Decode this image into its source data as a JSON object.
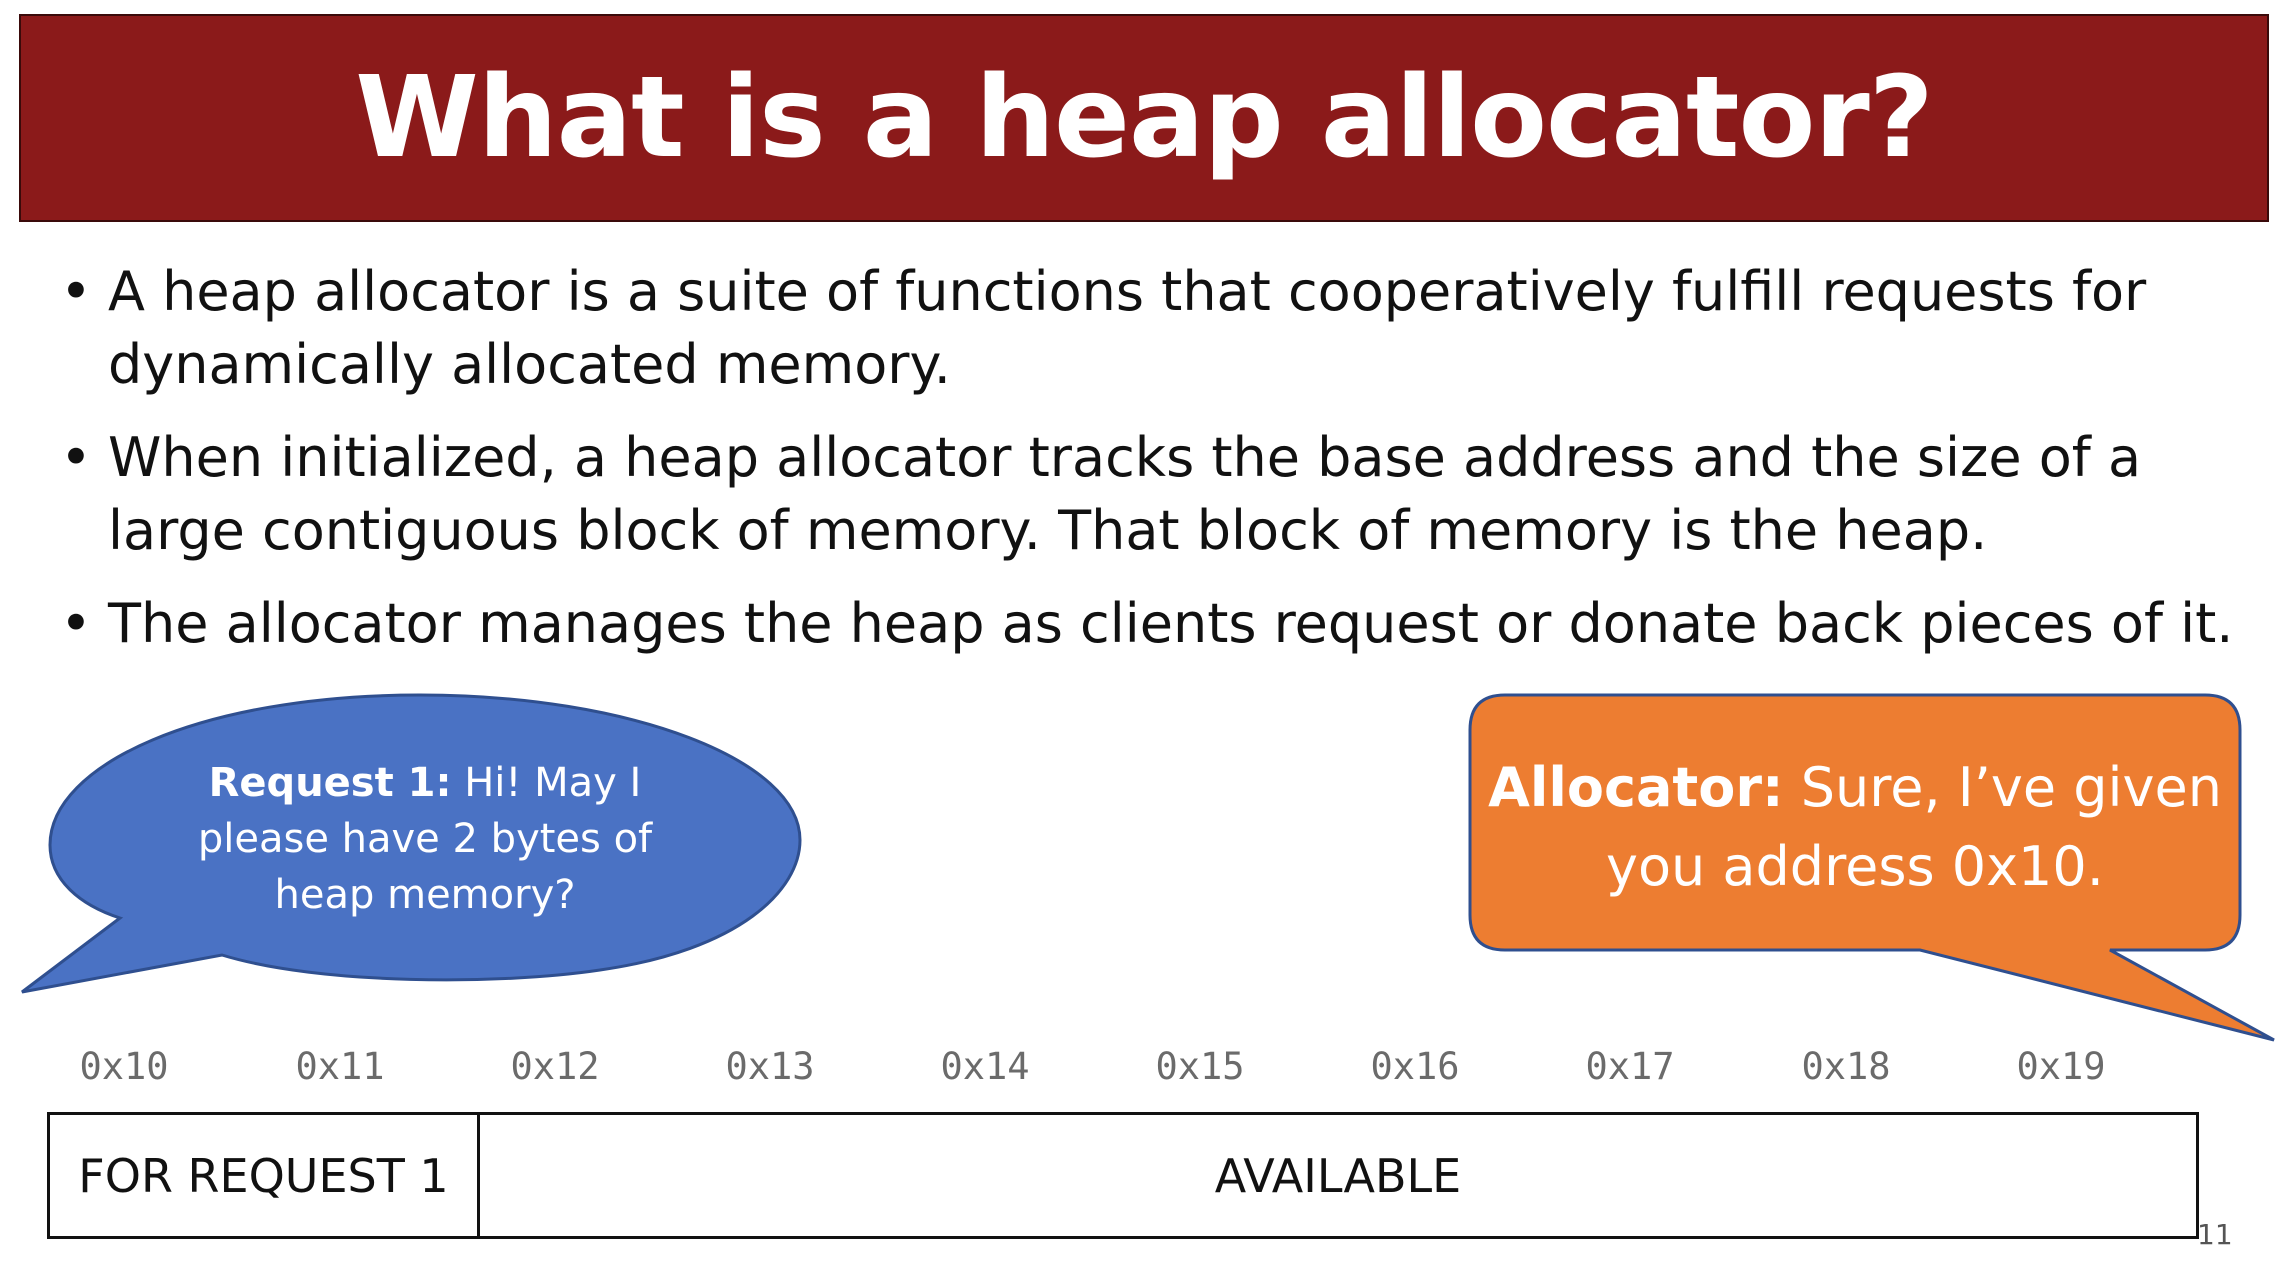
{
  "title": "What is a heap allocator?",
  "bullets": [
    "A heap allocator is a suite of functions that cooperatively fulfill requests for dynamically allocated memory.",
    "When initialized, a heap allocator tracks the base address and the size of a large contiguous block of memory.  That block of memory is the heap.",
    "The allocator manages the heap as clients request or donate back pieces of it."
  ],
  "bullet_symbol": "•",
  "request_bubble": {
    "label": "Request 1:",
    "text": " Hi!  May I please have 2 bytes of heap memory?",
    "color": "#4a72c4"
  },
  "allocator_bubble": {
    "label": "Allocator:",
    "text": " Sure, I’ve given you address 0x10.",
    "color": "#ed7d31"
  },
  "addresses": [
    "0x10",
    "0x11",
    "0x12",
    "0x13",
    "0x14",
    "0x15",
    "0x16",
    "0x17",
    "0x18",
    "0x19"
  ],
  "memory_blocks": {
    "allocated": "FOR REQUEST 1",
    "free": "AVAILABLE"
  },
  "page_number": "11",
  "colors": {
    "title_bar": "#8b1a1a",
    "address_text": "#6b6b6b"
  }
}
